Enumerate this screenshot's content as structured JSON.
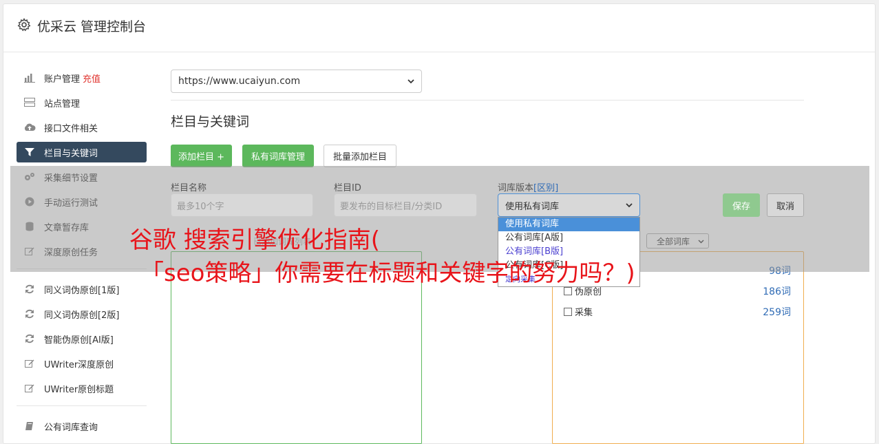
{
  "app": {
    "title": "优采云 管理控制台"
  },
  "sidebar": {
    "items": [
      {
        "label": "账户管理",
        "badge": "充值",
        "icon": "bar-chart-icon"
      },
      {
        "label": "站点管理",
        "icon": "server-icon"
      },
      {
        "label": "接口文件相关",
        "icon": "cloud-upload-icon"
      },
      {
        "label": "栏目与关键词",
        "icon": "filter-icon",
        "active": true
      },
      {
        "label": "采集细节设置",
        "icon": "cogs-icon"
      },
      {
        "label": "手动运行测试",
        "icon": "play-icon"
      },
      {
        "label": "文章暂存库",
        "icon": "database-icon"
      },
      {
        "label": "深度原创任务",
        "icon": "edit-icon"
      },
      {
        "label": "同义词伪原创[1版]",
        "icon": "refresh-icon"
      },
      {
        "label": "同义词伪原创[2版]",
        "icon": "refresh-icon"
      },
      {
        "label": "智能伪原创[AI版]",
        "icon": "refresh-icon"
      },
      {
        "label": "UWriter深度原创",
        "icon": "edit-icon"
      },
      {
        "label": "UWriter原创标题",
        "icon": "edit-icon"
      },
      {
        "label": "公有词库查询",
        "icon": "book-icon"
      }
    ]
  },
  "main": {
    "site_select": "https://www.ucaiyun.com",
    "section_title": "栏目与关键词",
    "buttons": {
      "add_column": "添加栏目 +",
      "private_lib": "私有词库管理",
      "batch_add": "批量添加栏目"
    },
    "form": {
      "column_name_label": "栏目名称",
      "column_name_placeholder": "最多10个字",
      "column_id_label": "栏目ID",
      "column_id_placeholder": "要发布的目标栏目/分类ID",
      "lib_version_label": "词库版本",
      "lib_version_link": "[区别]",
      "lib_version_value": "使用私有词库",
      "save": "保存",
      "cancel": "取消"
    },
    "dropdown_options": [
      "使用私有词库",
      "公有词库[A版]",
      "公有词库[B版]",
      "公有词库[C版]",
      "定向采集"
    ],
    "hint": "已添加词库列表",
    "filter_select": "全部词库",
    "keywords": [
      {
        "name": "",
        "count": "98词"
      },
      {
        "name": "伪原创",
        "count": "186词"
      },
      {
        "name": "采集",
        "count": "259词"
      }
    ]
  },
  "overlay_title": {
    "line1": "谷歌 搜索引擎优化指南(",
    "line2": "「seo策略」你需要在标题和关键字的努力吗？)"
  },
  "colors": {
    "active_nav": "#34495e",
    "green": "#5cb85c",
    "orange": "#f0ad4e",
    "red_title": "#e8141a"
  }
}
